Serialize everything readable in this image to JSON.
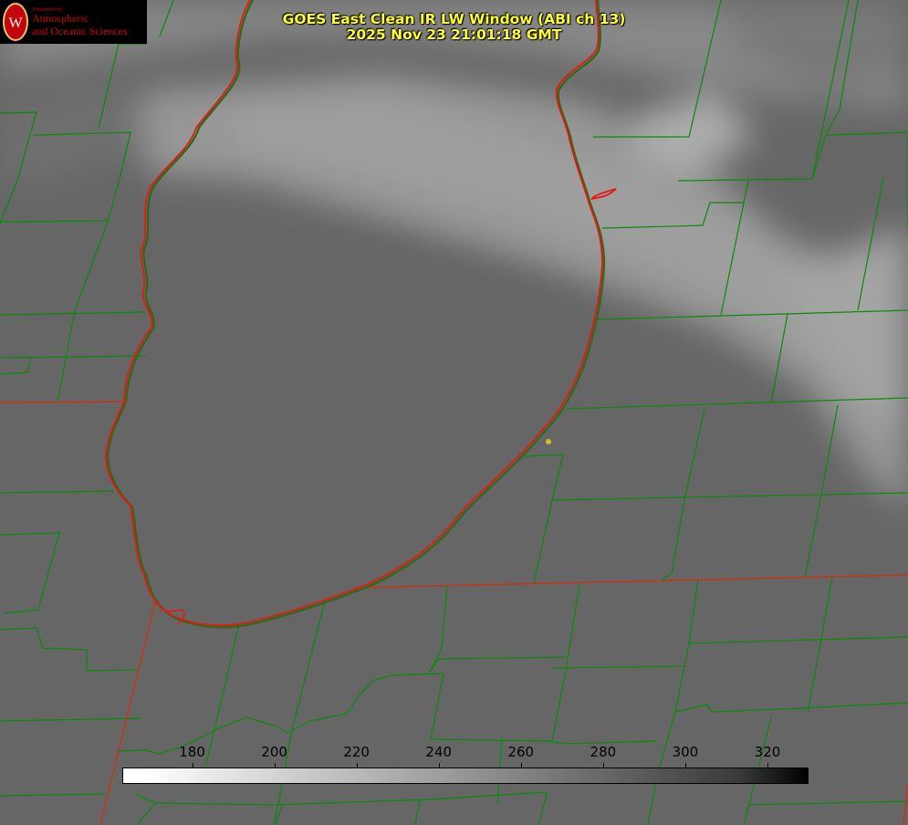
{
  "title": {
    "line1": "GOES East Clean IR LW Window (ABI ch 13)",
    "line2": "2025 Nov 23 21:01:18 GMT"
  },
  "logo": {
    "dept": "Department of",
    "line1": "Atmospheric",
    "line2": "and Oceanic Sciences",
    "crest_letter": "W",
    "color": "#c5050c"
  },
  "colorbar": {
    "ticks": [
      "180",
      "200",
      "220",
      "240",
      "260",
      "280",
      "300",
      "320"
    ],
    "tick_values": [
      180,
      200,
      220,
      240,
      260,
      280,
      300,
      320
    ],
    "range": [
      163,
      330
    ]
  },
  "colors": {
    "county_lines": "#0a8a0a",
    "state_lines": "#c2361a",
    "lake_outline": "#e8170f",
    "title": "#ffff33",
    "station_marker": "#d4c020"
  }
}
